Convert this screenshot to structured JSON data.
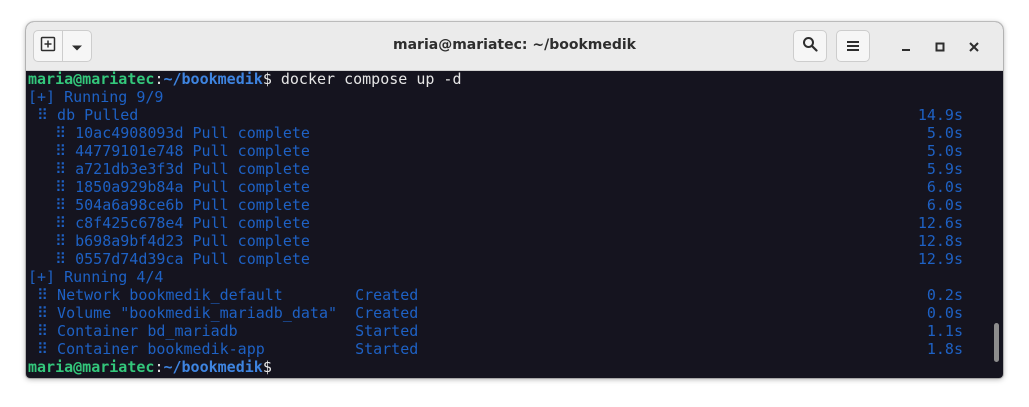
{
  "window": {
    "title": "maria@mariatec: ~/bookmedik"
  },
  "colors": {
    "background": "#15141f",
    "user_host": "#33c77b",
    "path": "#3e84e0",
    "progress": "#1e61c4",
    "text": "#e6e6e6"
  },
  "icons": {
    "new_tab": "new-tab-icon",
    "menu_dropdown": "chevron-down-icon",
    "search": "search-icon",
    "hamburger": "hamburger-menu-icon",
    "minimize": "minimize-icon",
    "maximize": "maximize-icon",
    "close": "close-icon"
  },
  "terminal": {
    "prompt1": {
      "user_host": "maria@mariatec",
      "colon": ":",
      "path": "~/bookmedik",
      "dollar": "$",
      "command": " docker compose up -d"
    },
    "running1": "[+] Running 9/9",
    "db": {
      "text": " ⠿ db Pulled",
      "time": "14.9s"
    },
    "layers": [
      {
        "text": "   ⠿ 10ac4908093d Pull complete",
        "time": "5.0s"
      },
      {
        "text": "   ⠿ 44779101e748 Pull complete",
        "time": "5.0s"
      },
      {
        "text": "   ⠿ a721db3e3f3d Pull complete",
        "time": "5.9s"
      },
      {
        "text": "   ⠿ 1850a929b84a Pull complete",
        "time": "6.0s"
      },
      {
        "text": "   ⠿ 504a6a98ce6b Pull complete",
        "time": "6.0s"
      },
      {
        "text": "   ⠿ c8f425c678e4 Pull complete",
        "time": "12.6s"
      },
      {
        "text": "   ⠿ b698a9bf4d23 Pull complete",
        "time": "12.8s"
      },
      {
        "text": "   ⠿ 0557d74d39ca Pull complete",
        "time": "12.9s"
      }
    ],
    "running2": "[+] Running 4/4",
    "resources": [
      {
        "text": " ⠿ Network bookmedik_default        Created",
        "time": "0.2s"
      },
      {
        "text": " ⠿ Volume \"bookmedik_mariadb_data\"  Created",
        "time": "0.0s"
      },
      {
        "text": " ⠿ Container bd_mariadb             Started",
        "time": "1.1s"
      },
      {
        "text": " ⠿ Container bookmedik-app          Started",
        "time": "1.8s"
      }
    ],
    "prompt2": {
      "user_host": "maria@mariatec",
      "colon": ":",
      "path": "~/bookmedik",
      "dollar": "$"
    }
  }
}
